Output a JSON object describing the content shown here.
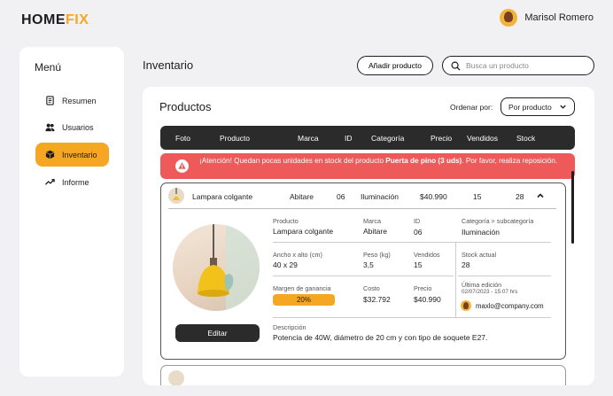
{
  "brand": {
    "part1": "HOME",
    "part2": "FIX"
  },
  "user": {
    "name": "Marisol Romero"
  },
  "sidebar": {
    "title": "Menú",
    "items": [
      {
        "label": "Resumen",
        "icon": "document-icon",
        "active": false
      },
      {
        "label": "Usuarios",
        "icon": "users-icon",
        "active": false
      },
      {
        "label": "Inventario",
        "icon": "box-icon",
        "active": true
      },
      {
        "label": "Informe",
        "icon": "trend-icon",
        "active": false
      }
    ]
  },
  "header": {
    "title": "Inventario",
    "add_button": "Añadir producto",
    "search_placeholder": "Busca un producto"
  },
  "panel": {
    "title": "Productos",
    "sort_label": "Ordenar por:",
    "sort_value": "Por producto"
  },
  "table": {
    "columns": [
      "Foto",
      "Producto",
      "Marca",
      "ID",
      "Categoría",
      "Precio",
      "Vendidos",
      "Stock"
    ]
  },
  "alert": {
    "prefix": "¡Atención! Quedan pocas unidades en stock del producto ",
    "product": "Puerta de pino (3 uds)",
    "suffix": ". Por favor, realiza reposición."
  },
  "product": {
    "name": "Lampara colgante",
    "brand": "Abitare",
    "id": "06",
    "category": "Iluminación",
    "price": "$40.990",
    "sold": "15",
    "stock": "28",
    "details": {
      "product_label": "Producto",
      "brand_label": "Marca",
      "id_label": "ID",
      "category_label": "Categoría > subcategoría",
      "size_label": "Ancho x alto (cm)",
      "size_value": "40 x 29",
      "weight_label": "Peso (kg)",
      "weight_value": "3,5",
      "sold_label": "Vendidos",
      "stock_label": "Stock actual",
      "margin_label": "Margen de ganancia",
      "margin_value": "20%",
      "cost_label": "Costo",
      "cost_value": "$32.792",
      "price_label": "Precio",
      "last_edit_label": "Última edición",
      "last_edit_date": "02/07/2023 - 15:07 hrs",
      "editor_email": "maxlo@company.com",
      "description_label": "Descripción",
      "description_value": "Potencia de 40W, diámetro de 20 cm y con tipo de soquete E27.",
      "edit_button": "Editar"
    }
  },
  "colors": {
    "accent": "#f5a623",
    "dark": "#2b2b2b",
    "alert": "#ee5a5a"
  }
}
